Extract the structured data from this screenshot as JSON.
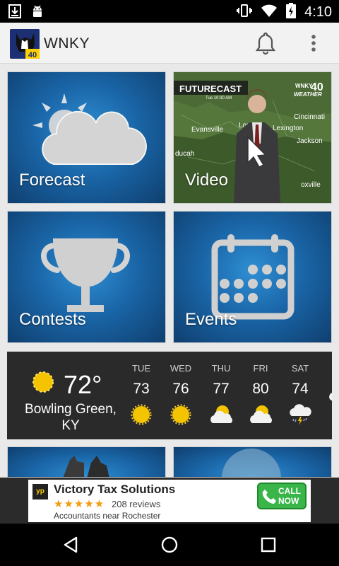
{
  "status_bar": {
    "time": "4:10",
    "icons": [
      "download-icon",
      "android-icon",
      "vibrate-icon",
      "wifi-icon",
      "battery-charging-icon"
    ]
  },
  "app_bar": {
    "logo_text": "40",
    "title": "WNKY",
    "icons": [
      "bell-icon",
      "overflow-menu-icon"
    ]
  },
  "tiles": [
    {
      "label": "Forecast",
      "icon": "sun-cloud-icon"
    },
    {
      "label": "Video",
      "icon": "video-thumbnail"
    },
    {
      "label": "Contests",
      "icon": "trophy-icon"
    },
    {
      "label": "Events",
      "icon": "calendar-icon"
    }
  ],
  "video_thumb": {
    "banner": "FUTURECAST",
    "banner_sub": "Tue 10:30 AM",
    "brand": "WNKY",
    "brand_num": "40",
    "brand_sub": "WEATHER",
    "cities": [
      "Evansville",
      "Louis",
      "Lexington",
      "Cincinnati",
      "Jackson",
      "ducah",
      "oxville"
    ]
  },
  "weather": {
    "current_temp": "72°",
    "city": "Bowling Green, KY",
    "forecast": [
      {
        "day": "TUE",
        "temp": "73",
        "icon": "sunny-icon"
      },
      {
        "day": "WED",
        "temp": "76",
        "icon": "sunny-icon"
      },
      {
        "day": "THU",
        "temp": "77",
        "icon": "partly-cloudy-icon"
      },
      {
        "day": "FRI",
        "temp": "80",
        "icon": "partly-cloudy-icon"
      },
      {
        "day": "SAT",
        "temp": "74",
        "icon": "thunderstorm-icon"
      },
      {
        "day": "S",
        "temp": "",
        "icon": "partly-cloudy-icon"
      }
    ]
  },
  "ad": {
    "yp": "yp",
    "name": "Victory Tax Solutions",
    "stars": "★★★★★",
    "reviews": "208 reviews",
    "subtitle": "Accountants near Rochester",
    "call_line1": "CALL",
    "call_line2": "NOW"
  },
  "colors": {
    "tile_blue": "#1a66a8",
    "weather_bg": "#2a2a2a",
    "sun": "#f5c400",
    "call_green": "#39b54a"
  }
}
